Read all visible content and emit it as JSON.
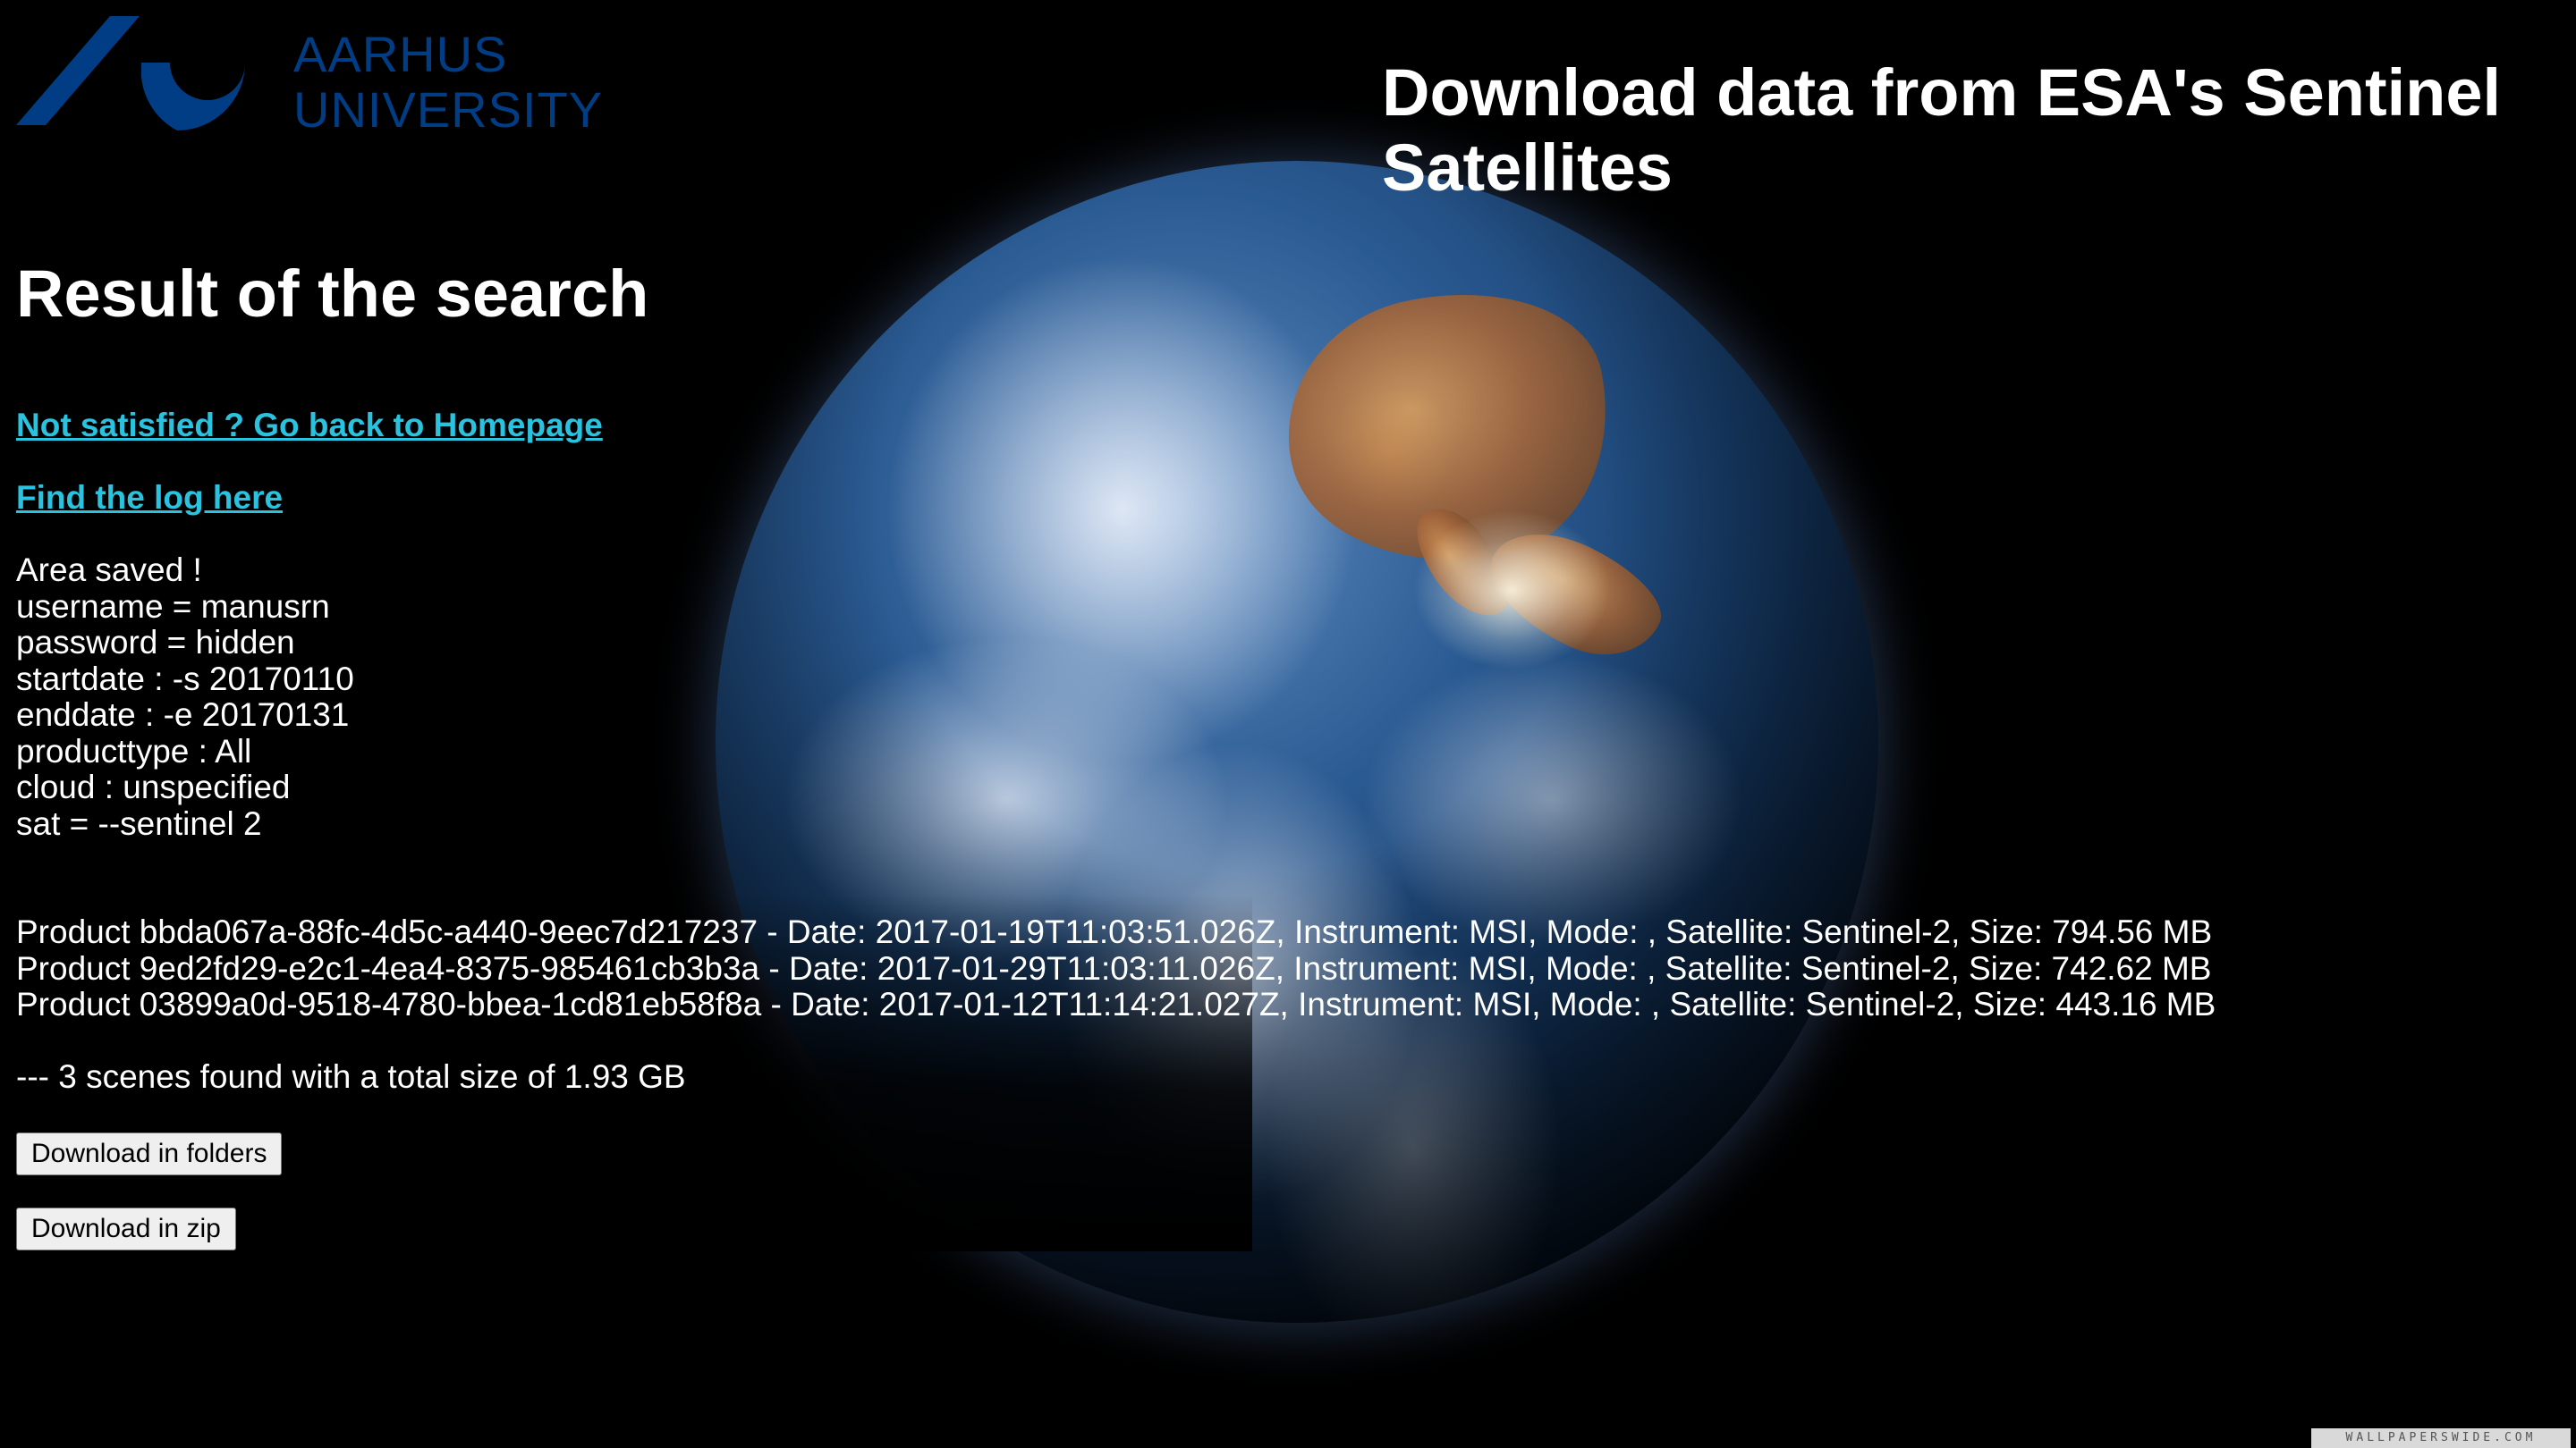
{
  "logo": {
    "line1": "AARHUS",
    "line2": "UNIVERSITY",
    "color": "#003d85"
  },
  "site_title": "Download data from ESA's Sentinel Satellites",
  "page_title": "Result of the search",
  "links": {
    "homepage": "Not satisfied ? Go back to Homepage",
    "log": "Find the log here"
  },
  "params": [
    "Area saved !",
    "username = manusrn",
    "password = hidden",
    "startdate : -s 20170110",
    "enddate : -e 20170131",
    "producttype : All",
    "cloud : unspecified",
    "sat = --sentinel 2"
  ],
  "products": [
    "Product bbda067a-88fc-4d5c-a440-9eec7d217237 - Date: 2017-01-19T11:03:51.026Z, Instrument: MSI, Mode: , Satellite: Sentinel-2, Size: 794.56 MB",
    "Product 9ed2fd29-e2c1-4ea4-8375-985461cb3b3a - Date: 2017-01-29T11:03:11.026Z, Instrument: MSI, Mode: , Satellite: Sentinel-2, Size: 742.62 MB",
    "Product 03899a0d-9518-4780-bbea-1cd81eb58f8a - Date: 2017-01-12T11:14:21.027Z, Instrument: MSI, Mode: , Satellite: Sentinel-2, Size: 443.16 MB"
  ],
  "summary": "--- 3 scenes found with a total size of 1.93 GB",
  "buttons": {
    "download_folders": "Download in folders",
    "download_zip": "Download in zip"
  },
  "watermark": "WALLPAPERSWIDE.COM",
  "colors": {
    "link": "#29c3e0",
    "background": "#000000"
  }
}
